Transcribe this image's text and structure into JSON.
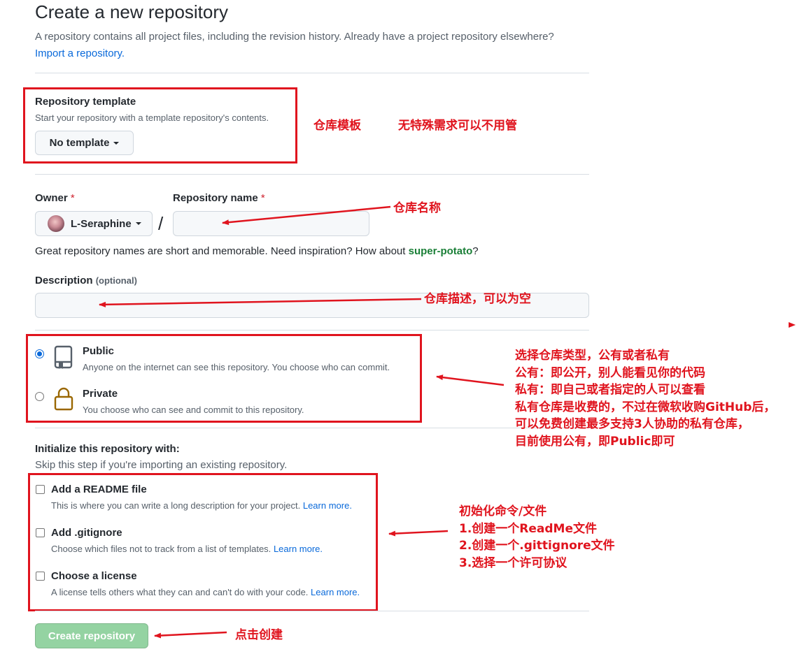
{
  "header": {
    "title": "Create a new repository",
    "subtitle": "A repository contains all project files, including the revision history. Already have a project repository elsewhere?",
    "import_link": "Import a repository."
  },
  "template": {
    "label": "Repository template",
    "hint": "Start your repository with a template repository's contents.",
    "button": "No template"
  },
  "owner": {
    "label": "Owner",
    "required_mark": "*",
    "value": "L-Seraphine"
  },
  "repo_name": {
    "label": "Repository name",
    "required_mark": "*",
    "value": "",
    "slash": "/"
  },
  "suggestion": {
    "text": "Great repository names are short and memorable. Need inspiration? How about ",
    "name": "super-potato",
    "end": "?"
  },
  "description": {
    "label": "Description",
    "optional": "(optional)",
    "value": ""
  },
  "visibility": {
    "options": [
      {
        "title": "Public",
        "desc": "Anyone on the internet can see this repository. You choose who can commit.",
        "selected": true
      },
      {
        "title": "Private",
        "desc": "You choose who can see and commit to this repository.",
        "selected": false
      }
    ]
  },
  "init": {
    "title": "Initialize this repository with:",
    "hint": "Skip this step if you're importing an existing repository.",
    "learn_more": "Learn more.",
    "options": [
      {
        "title": "Add a README file",
        "desc": "This is where you can write a long description for your project.",
        "checked": false
      },
      {
        "title": "Add .gitignore",
        "desc": "Choose which files not to track from a list of templates.",
        "checked": false
      },
      {
        "title": "Choose a license",
        "desc": "A license tells others what they can and can't do with your code.",
        "checked": false
      }
    ]
  },
  "create_button": "Create repository",
  "annotations": {
    "template_a": "仓库模板",
    "template_b": "无特殊需求可以不用管",
    "name": "仓库名称",
    "description": "仓库描述，可以为空",
    "visibility": [
      "选择仓库类型，公有或者私有",
      "公有：即公开，别人能看见你的代码",
      "私有：即自己或者指定的人可以查看",
      "私有仓库是收费的，不过在微软收购GitHub后，",
      "可以免费创建最多支持3人协助的私有仓库，",
      "目前使用公有，即Public即可"
    ],
    "init": [
      "初始化命令/文件",
      "1.创建一个ReadMe文件",
      "2.创建一个.gittignore文件",
      "3.选择一个许可协议"
    ],
    "create": "点击创建"
  },
  "colors": {
    "annotation_red": "#e0141e",
    "link_blue": "#0969da",
    "create_green_disabled": "#94d3a2",
    "suggestion_green": "#1a7f37"
  }
}
